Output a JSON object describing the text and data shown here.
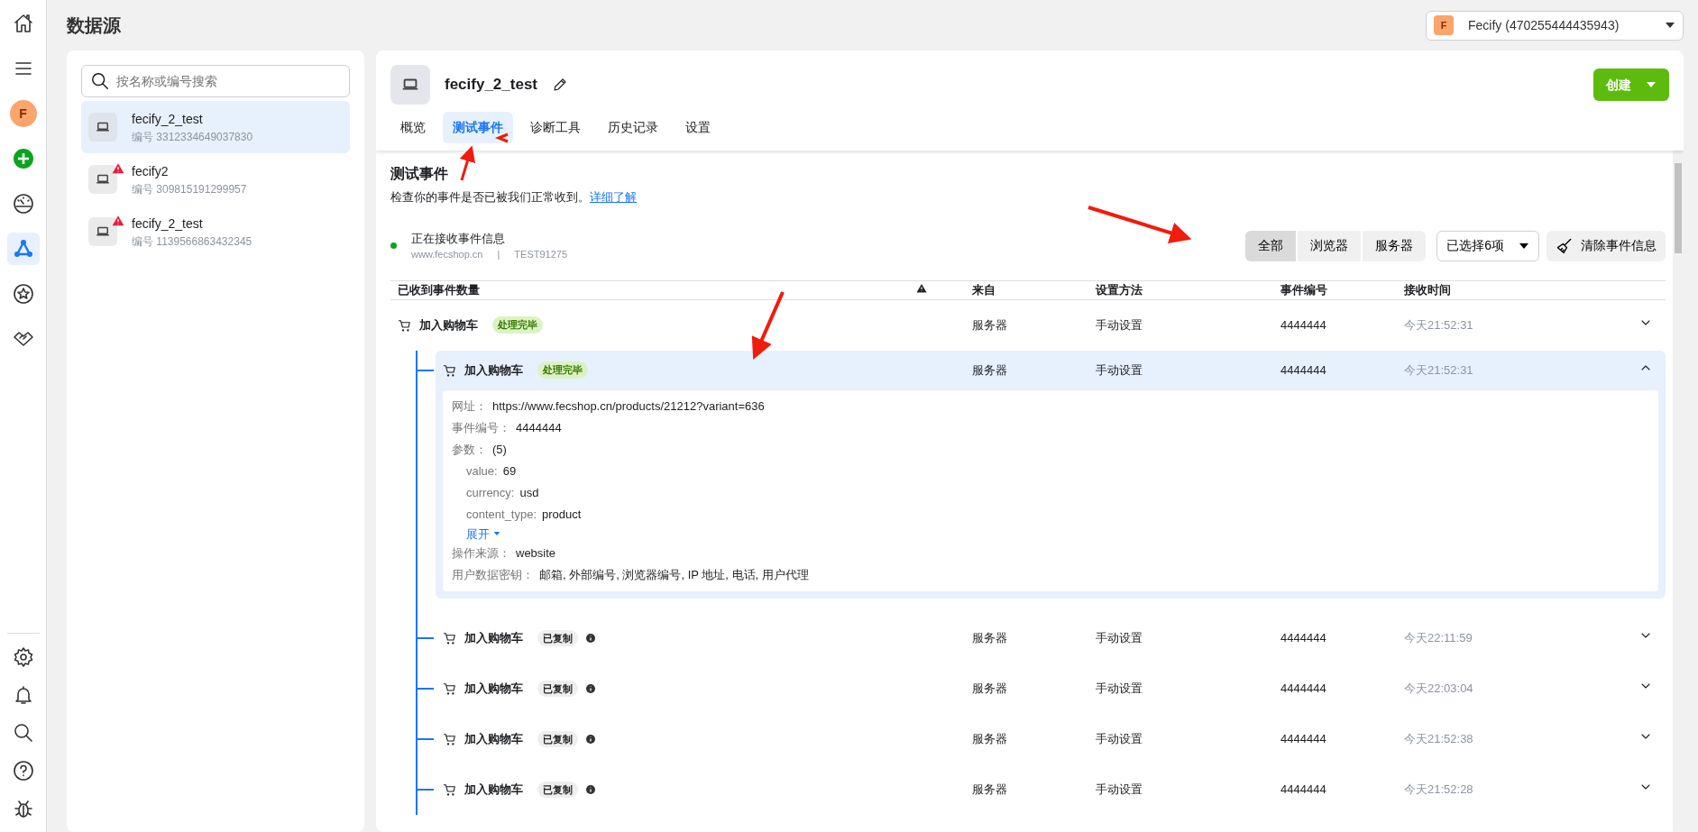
{
  "rail": {
    "top": [
      {
        "kind": "home",
        "selected": false
      },
      {
        "kind": "menu",
        "selected": false
      },
      {
        "kind": "avatar",
        "letter": "F",
        "selected": false
      },
      {
        "kind": "add",
        "selected": false
      },
      {
        "kind": "gauge",
        "selected": false
      },
      {
        "kind": "network",
        "selected": true
      },
      {
        "kind": "star",
        "selected": false
      },
      {
        "kind": "handshake",
        "selected": false
      }
    ],
    "bottom": [
      {
        "kind": "gear",
        "selected": false
      },
      {
        "kind": "bell",
        "selected": false
      },
      {
        "kind": "search",
        "selected": false
      },
      {
        "kind": "help",
        "selected": false
      },
      {
        "kind": "bug",
        "selected": false
      }
    ]
  },
  "page_title": "数据源",
  "account": {
    "letter": "F",
    "label": "Fecify (470255444435943)"
  },
  "sources": {
    "search": {
      "placeholder": "按名称或编号搜索"
    },
    "items": [
      {
        "name": "fecify_2_test",
        "id_label": "编号",
        "id": "3312334649037830",
        "selected": true,
        "warning": false
      },
      {
        "name": "fecify2",
        "id_label": "编号",
        "id": "309815191299957",
        "selected": false,
        "warning": true
      },
      {
        "name": "fecify_2_test",
        "id_label": "编号",
        "id": "1139566863432345",
        "selected": false,
        "warning": true
      }
    ]
  },
  "detail": {
    "name": "fecify_2_test",
    "create_button": "创建",
    "tabs": [
      {
        "label": "概览",
        "selected": false
      },
      {
        "label": "测试事件",
        "selected": true
      },
      {
        "label": "诊断工具",
        "selected": false
      },
      {
        "label": "历史记录",
        "selected": false
      },
      {
        "label": "设置",
        "selected": false
      }
    ],
    "section_title": "测试事件",
    "description": "检查你的事件是否已被我们正常收到。",
    "learn_more": "详细了解",
    "status": {
      "receiving": true,
      "text": "正在接收事件信息",
      "domain": "www.fecshop.cn",
      "separator": "|",
      "code": "TEST91275"
    },
    "filters": [
      {
        "label": "全部",
        "selected": true
      },
      {
        "label": "浏览器",
        "selected": false
      },
      {
        "label": "服务器",
        "selected": false
      }
    ],
    "select": {
      "label": "已选择6项"
    },
    "clear_button": "清除事件信息",
    "table": {
      "columns": [
        {
          "kind": "text",
          "label": "已收到事件数量"
        },
        {
          "kind": "warning"
        },
        {
          "kind": "text",
          "label": "来自"
        },
        {
          "kind": "text",
          "label": "设置方法"
        },
        {
          "kind": "text",
          "label": "事件编号"
        },
        {
          "kind": "text",
          "label": "接收时间"
        }
      ],
      "rows": [
        {
          "name": "加入购物车",
          "badge": {
            "kind": "success",
            "label": "处理完毕"
          },
          "info": false,
          "source": "服务器",
          "method": "手动设置",
          "event_id": "4444444",
          "time": "今天21:52:31",
          "expanded": false,
          "children": [
            {
              "name": "加入购物车",
              "badge": {
                "kind": "success",
                "label": "处理完毕"
              },
              "info": false,
              "source": "服务器",
              "method": "手动设置",
              "event_id": "4444444",
              "time": "今天21:52:31",
              "expanded": true,
              "details": [
                {
                  "label": "网址：",
                  "value": "https://www.fecshop.cn/products/21212?variant=636"
                },
                {
                  "label": "事件编号：",
                  "value": "4444444"
                },
                {
                  "label": "参数：",
                  "value": "(5)",
                  "children": [
                    {
                      "label": "value:",
                      "value": "69"
                    },
                    {
                      "label": "currency:",
                      "value": "usd"
                    },
                    {
                      "label": "content_type:",
                      "value": "product"
                    }
                  ],
                  "more": "展开"
                },
                {
                  "label": "操作来源：",
                  "value": "website"
                },
                {
                  "label": "用户数据密钥：",
                  "value": "邮箱, 外部编号, 浏览器编号, IP 地址, 电话, 用户代理"
                }
              ]
            },
            {
              "name": "加入购物车",
              "badge": {
                "kind": "neutral",
                "label": "已复制"
              },
              "info": true,
              "source": "服务器",
              "method": "手动设置",
              "event_id": "4444444",
              "time": "今天22:11:59",
              "expanded": false
            },
            {
              "name": "加入购物车",
              "badge": {
                "kind": "neutral",
                "label": "已复制"
              },
              "info": true,
              "source": "服务器",
              "method": "手动设置",
              "event_id": "4444444",
              "time": "今天22:03:04",
              "expanded": false
            },
            {
              "name": "加入购物车",
              "badge": {
                "kind": "neutral",
                "label": "已复制"
              },
              "info": true,
              "source": "服务器",
              "method": "手动设置",
              "event_id": "4444444",
              "time": "今天21:52:38",
              "expanded": false
            },
            {
              "name": "加入购物车",
              "badge": {
                "kind": "neutral",
                "label": "已复制"
              },
              "info": true,
              "source": "服务器",
              "method": "手动设置",
              "event_id": "4444444",
              "time": "今天21:52:28",
              "expanded": false
            }
          ]
        }
      ]
    }
  }
}
